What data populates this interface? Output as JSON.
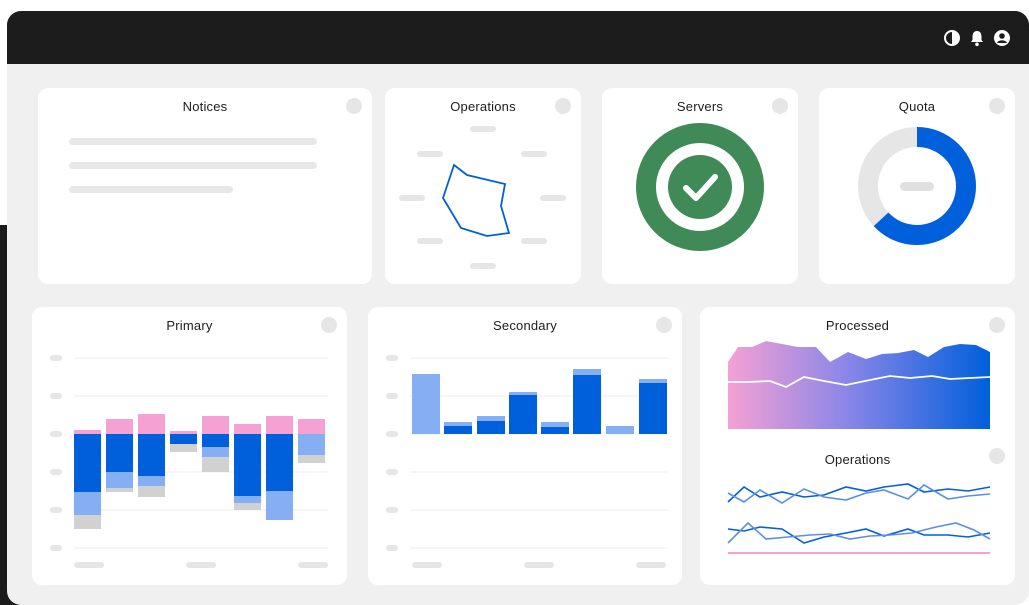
{
  "topbar": {
    "icons": [
      "contrast-icon",
      "bell-icon",
      "user-icon"
    ]
  },
  "cards": {
    "notices": {
      "title": "Notices"
    },
    "operations_radar": {
      "title": "Operations"
    },
    "servers": {
      "title": "Servers",
      "status": "ok",
      "color": "#3f8a57"
    },
    "quota": {
      "title": "Quota",
      "used_fraction": 0.63,
      "color": "#005fdb"
    },
    "primary": {
      "title": "Primary"
    },
    "secondary": {
      "title": "Secondary"
    },
    "processed": {
      "title": "Processed"
    },
    "operations_lines": {
      "title": "Operations"
    }
  },
  "colors": {
    "accent_blue": "#005fdb",
    "light_blue": "#86aef2",
    "pink": "#f5a1d3",
    "gray": "#d1d1d1",
    "green": "#3f8a57"
  }
}
